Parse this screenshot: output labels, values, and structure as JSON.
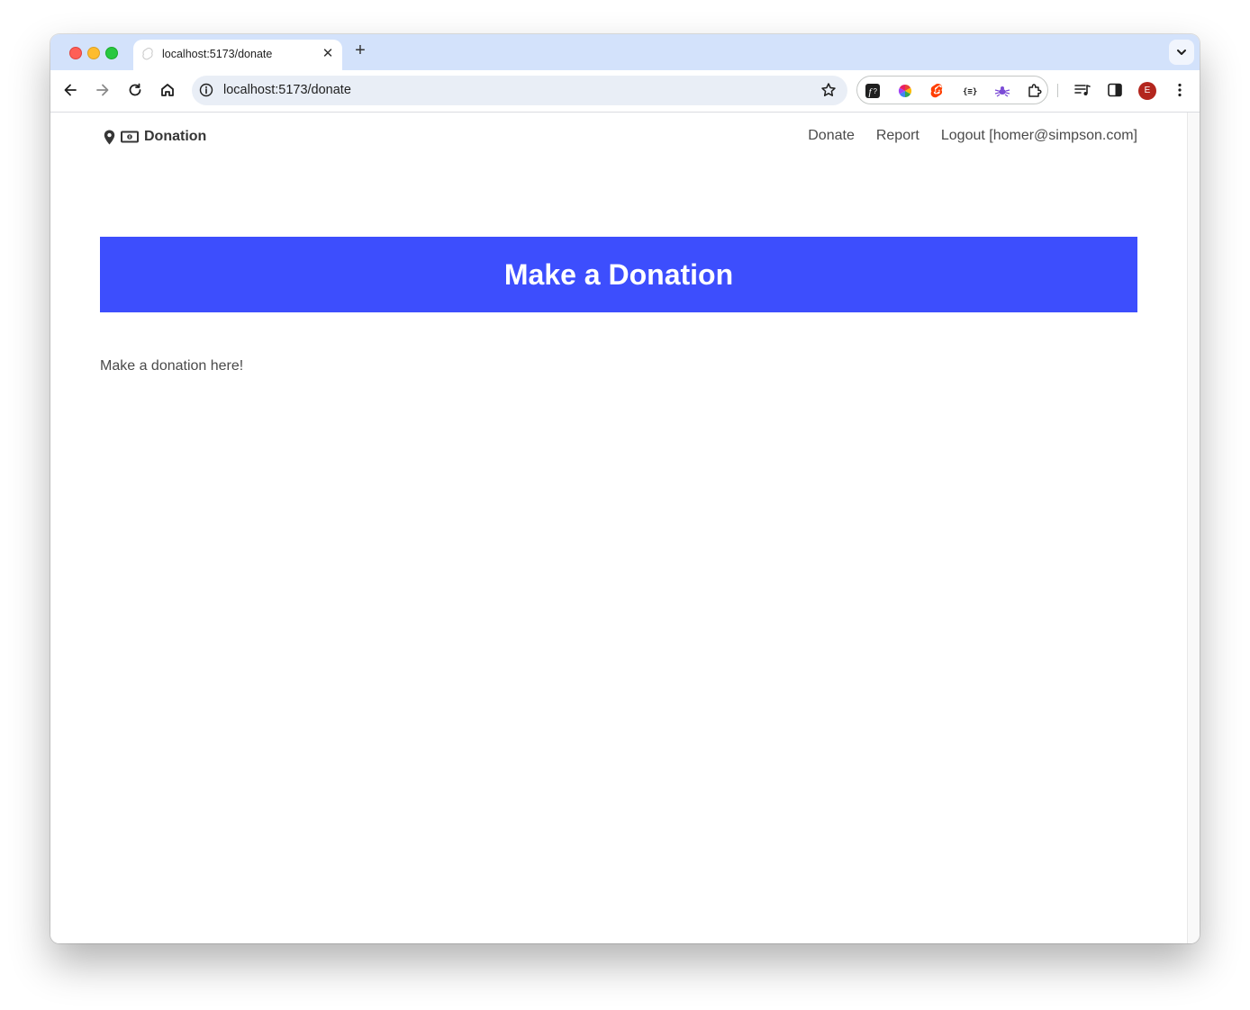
{
  "browser": {
    "tab": {
      "title": "localhost:5173/donate",
      "favicon": "svelte-icon"
    },
    "address_bar": {
      "url": "localhost:5173/donate"
    },
    "profile_initial": "E",
    "extensions": [
      "fontface-ninja-icon",
      "color-wheel-icon",
      "svelte-icon",
      "json-formatter-icon",
      "bug-icon",
      "puzzle-icon"
    ]
  },
  "navbar": {
    "brand": "Donation",
    "links": [
      "Donate",
      "Report",
      "Logout [homer@simpson.com]"
    ]
  },
  "hero": {
    "title": "Make a Donation"
  },
  "content": {
    "text": "Make a donation here!"
  },
  "colors": {
    "hero_background": "#3d4efd",
    "tabstrip": "#d3e2fb",
    "text": "#4a4a4a"
  }
}
